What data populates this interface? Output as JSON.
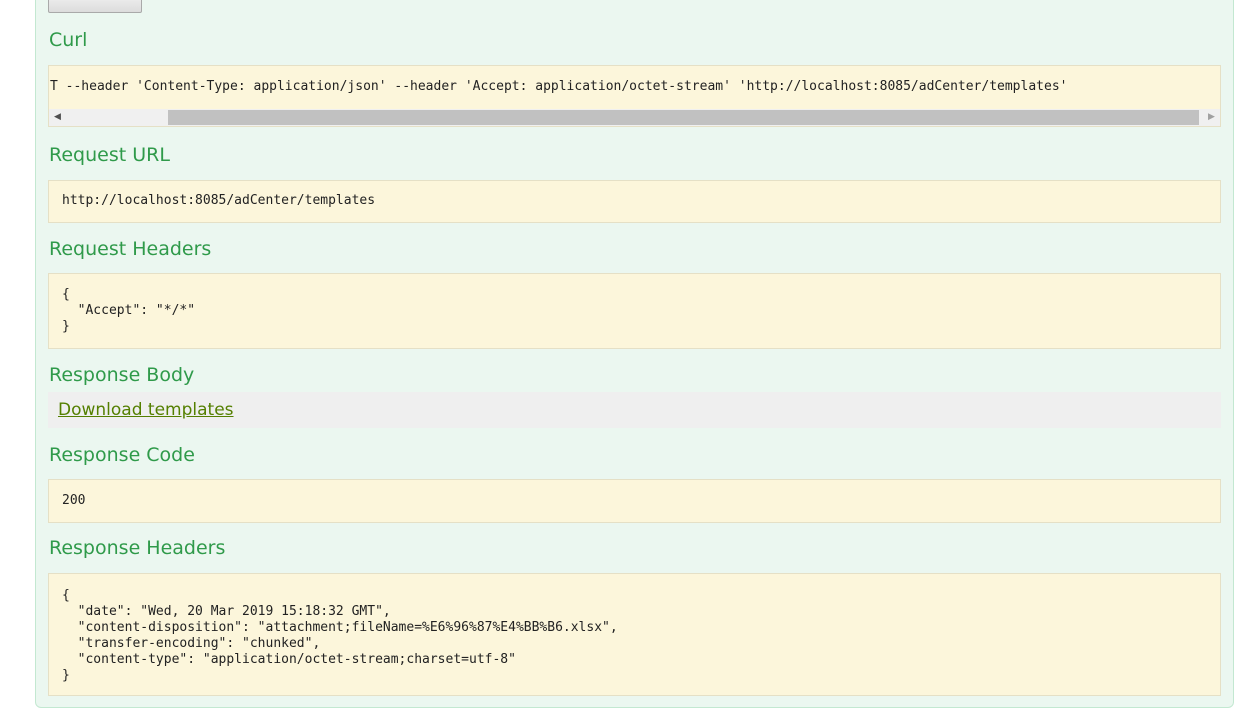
{
  "sections": {
    "curl": {
      "title": "Curl",
      "command": "T --header 'Content-Type: application/json' --header 'Accept: application/octet-stream' 'http://localhost:8085/adCenter/templates'"
    },
    "request_url": {
      "title": "Request URL",
      "value": "http://localhost:8085/adCenter/templates"
    },
    "request_headers": {
      "title": "Request Headers",
      "value": "{\n  \"Accept\": \"*/*\"\n}"
    },
    "response_body": {
      "title": "Response Body",
      "link_label": "Download templates"
    },
    "response_code": {
      "title": "Response Code",
      "value": "200"
    },
    "response_headers": {
      "title": "Response Headers",
      "value": "{\n  \"date\": \"Wed, 20 Mar 2019 15:18:32 GMT\",\n  \"content-disposition\": \"attachment;fileName=%E6%96%87%E4%BB%B6.xlsx\",\n  \"transfer-encoding\": \"chunked\",\n  \"content-type\": \"application/octet-stream;charset=utf-8\"\n}"
    }
  },
  "colors": {
    "heading": "#2f9a4a",
    "panel_background": "#ebf7f0",
    "code_background": "#fcf6db",
    "link": "#547f00"
  },
  "icons": {
    "scroll_left": "triangle-left-icon",
    "scroll_right": "triangle-right-icon"
  }
}
